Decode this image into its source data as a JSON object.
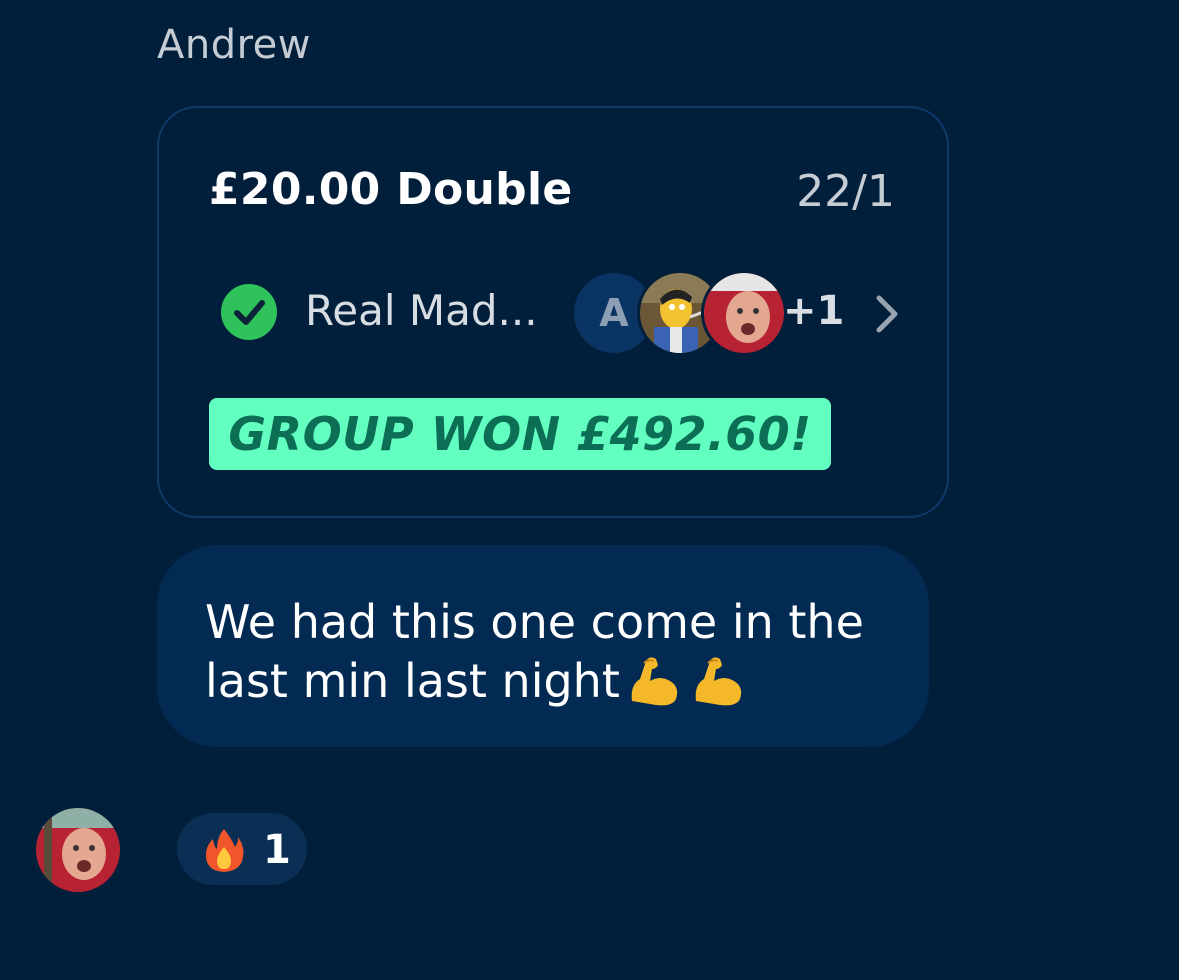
{
  "message": {
    "sender": "Andrew",
    "bet": {
      "title": "£20.00 Double",
      "odds": "22/1",
      "selection": "Real Mad...",
      "selection_status_icon": "check-circle-icon",
      "avatar_letter": "A",
      "extra_participants": "+1",
      "result_banner": "GROUP WON £492.60!"
    },
    "text": "We had this one come in the last min last night",
    "text_emoji": "flexed-biceps-icon"
  },
  "reaction": {
    "icon": "fire-icon",
    "count": "1"
  },
  "colors": {
    "background": "#011e3a",
    "bubble": "#032a52",
    "card_border": "#0f3b6b",
    "win_banner": "#63ffc1",
    "win_text": "#0c6f55",
    "check_green": "#2fc25a"
  }
}
